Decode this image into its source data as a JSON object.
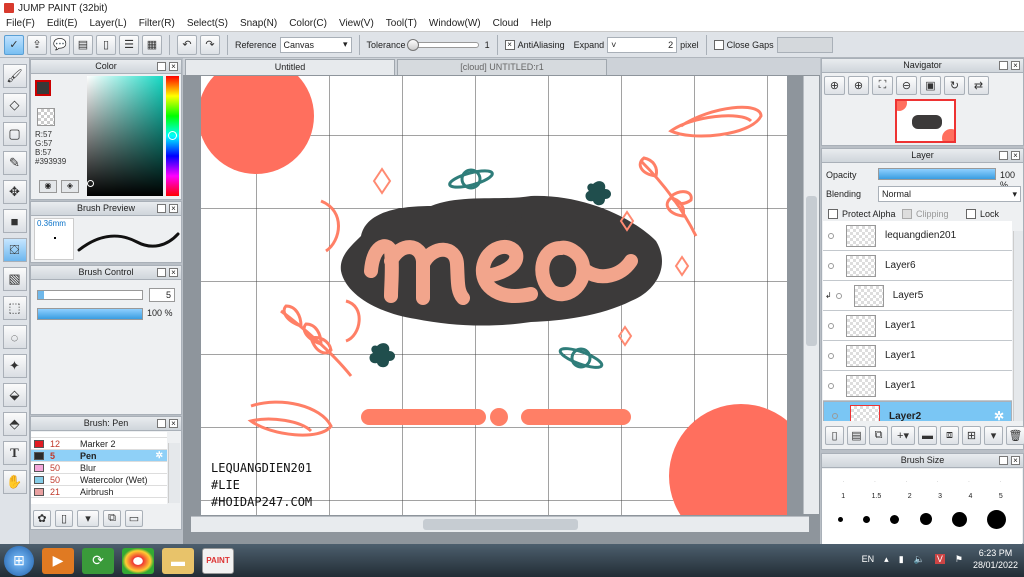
{
  "app": {
    "title": "JUMP PAINT (32bit)"
  },
  "menu": [
    "File(F)",
    "Edit(E)",
    "Layer(L)",
    "Filter(R)",
    "Select(S)",
    "Snap(N)",
    "Color(C)",
    "View(V)",
    "Tool(T)",
    "Window(W)",
    "Cloud",
    "Help"
  ],
  "toolbar": {
    "reference_label": "Reference",
    "reference_value": "Canvas",
    "tolerance_label": "Tolerance",
    "tolerance_value": "1",
    "antialiasing_label": "AntiAliasing",
    "expand_label": "Expand",
    "expand_value": "2",
    "expand_unit": "pixel",
    "closegaps_label": "Close Gaps"
  },
  "color_panel": {
    "title": "Color",
    "r": "R:57",
    "g": "G:57",
    "b": "B:57",
    "hex": "#393939",
    "main_color": "#393939"
  },
  "brush_preview": {
    "title": "Brush Preview",
    "size": "0.36mm"
  },
  "brush_control": {
    "title": "Brush Control",
    "size_value": "5",
    "opacity_value": "100",
    "opacity_unit": "%"
  },
  "brush_list": {
    "title": "Brush: Pen",
    "items": [
      {
        "size": "12",
        "name": "Marker 2",
        "color": "#e11b22"
      },
      {
        "size": "5",
        "name": "Pen",
        "color": "#2b2b2b",
        "selected": true
      },
      {
        "size": "50",
        "name": "Blur",
        "color": "#f4a6d9"
      },
      {
        "size": "50",
        "name": "Watercolor (Wet)",
        "color": "#86cde8"
      },
      {
        "size": "21",
        "name": "Airbrush",
        "color": "#e9a1a1"
      }
    ]
  },
  "tabs": [
    "Untitled",
    "[cloud] UNTITLED:r1"
  ],
  "artwork": {
    "word": "mèo",
    "signature": [
      "LEQUANGDIEN201",
      "#LIE",
      "#HOIDAP247.COM"
    ]
  },
  "navigator": {
    "title": "Navigator"
  },
  "layers": {
    "title": "Layer",
    "opacity_label": "Opacity",
    "opacity_value": "100",
    "opacity_unit": "%",
    "blending_label": "Blending",
    "blending_value": "Normal",
    "protect_alpha": "Protect Alpha",
    "clipping": "Clipping",
    "lock": "Lock",
    "items": [
      {
        "name": "lequangdien201"
      },
      {
        "name": "Layer6"
      },
      {
        "name": "Layer5",
        "indent": true
      },
      {
        "name": "Layer1"
      },
      {
        "name": "Layer1"
      },
      {
        "name": "Layer1"
      },
      {
        "name": "Layer2",
        "selected": true
      }
    ]
  },
  "brush_size": {
    "title": "Brush Size",
    "labels": [
      "1",
      "1.5",
      "2",
      "3",
      "4",
      "5"
    ]
  },
  "taskbar": {
    "lang": "EN",
    "time": "6:23 PM",
    "date": "28/01/2022"
  }
}
